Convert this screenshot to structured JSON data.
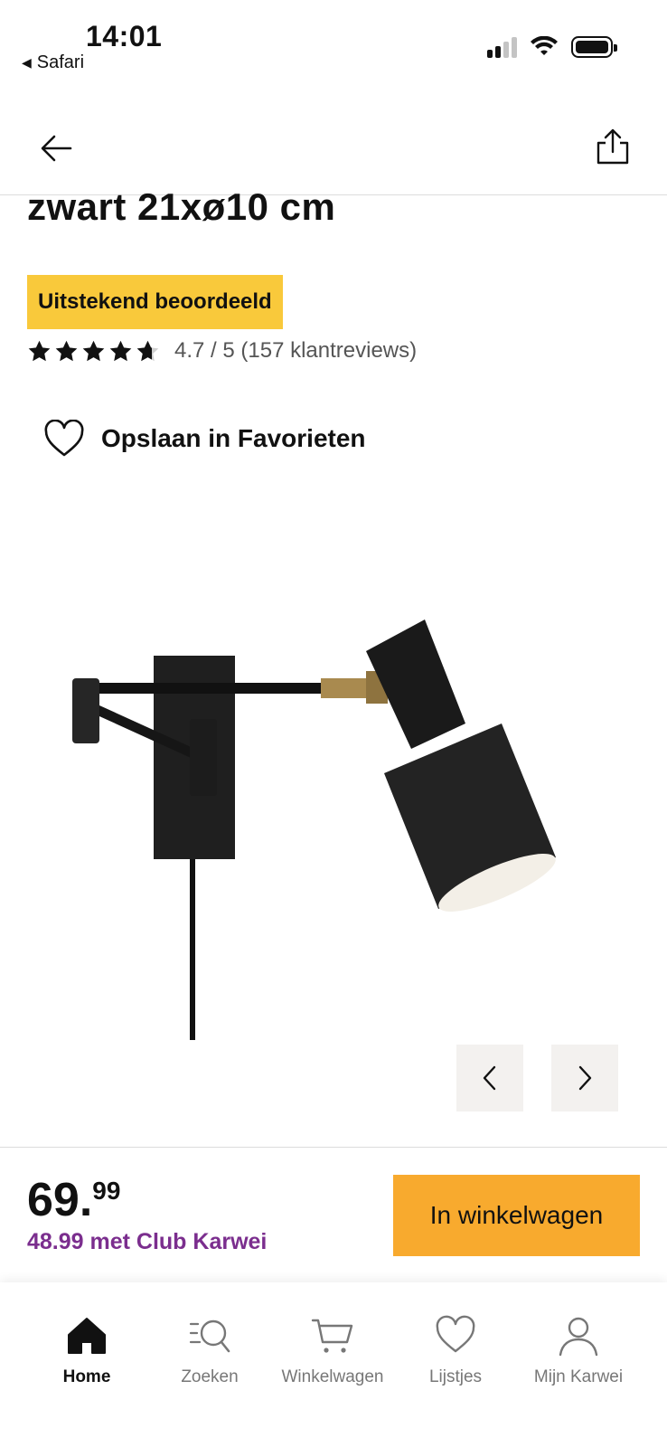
{
  "status": {
    "time": "14:01",
    "back_app": "Safari"
  },
  "product": {
    "title": "zwart 21xø10 cm",
    "badge": "Uitstekend beoordeeld",
    "rating_value": 4.7,
    "rating_text": "4.7 / 5 (157 klantreviews)",
    "favorite_label": "Opslaan in Favorieten"
  },
  "price": {
    "integer": "69.",
    "decimals": "99",
    "club": "48.99 met Club Karwei"
  },
  "cart_button": "In winkelwagen",
  "tabs": [
    {
      "label": "Home",
      "icon": "home-icon"
    },
    {
      "label": "Zoeken",
      "icon": "search-icon"
    },
    {
      "label": "Winkelwagen",
      "icon": "cart-icon"
    },
    {
      "label": "Lijstjes",
      "icon": "heart-icon"
    },
    {
      "label": "Mijn Karwei",
      "icon": "user-icon"
    }
  ],
  "colors": {
    "badge": "#f9c93b",
    "cart_button": "#f8aa2e",
    "club_price": "#7b2e8e"
  }
}
